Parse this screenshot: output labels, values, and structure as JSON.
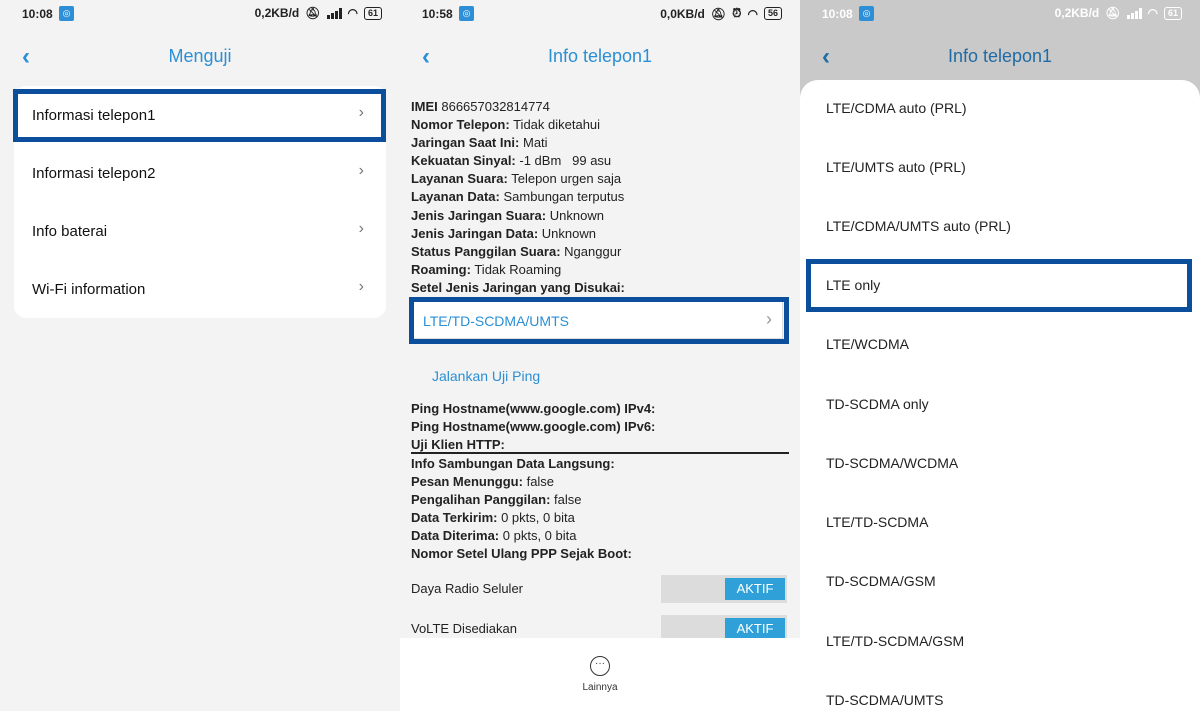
{
  "screen1": {
    "status": {
      "time": "10:08",
      "speed": "0,2KB/d",
      "battery": "61"
    },
    "header": {
      "title": "Menguji"
    },
    "menu": [
      {
        "label": "Informasi telepon1"
      },
      {
        "label": "Informasi telepon2"
      },
      {
        "label": "Info baterai"
      },
      {
        "label": "Wi-Fi information"
      }
    ]
  },
  "screen2": {
    "status": {
      "time": "10:58",
      "speed": "0,0KB/d",
      "battery": "56"
    },
    "header": {
      "title": "Info telepon1"
    },
    "info": [
      {
        "k": "IMEI",
        "v": "866657032814774"
      },
      {
        "k": "Nomor Telepon:",
        "v": "Tidak diketahui"
      },
      {
        "k": "Jaringan Saat Ini:",
        "v": "Mati"
      },
      {
        "k": "Kekuatan Sinyal:",
        "v": "-1 dBm   99 asu"
      },
      {
        "k": "Layanan Suara:",
        "v": "Telepon urgen saja"
      },
      {
        "k": "Layanan Data:",
        "v": "Sambungan terputus"
      },
      {
        "k": "Jenis Jaringan Suara:",
        "v": "Unknown"
      },
      {
        "k": "Jenis Jaringan Data:",
        "v": "Unknown"
      },
      {
        "k": "Status Panggilan Suara:",
        "v": "Nganggur"
      },
      {
        "k": "Roaming:",
        "v": "Tidak Roaming"
      },
      {
        "k": "Setel Jenis Jaringan yang Disukai:",
        "v": ""
      }
    ],
    "preferred_network": "LTE/TD-SCDMA/UMTS",
    "ping_button": "Jalankan Uji Ping",
    "ping": [
      {
        "k": "Ping Hostname(www.google.com) IPv4:",
        "v": ""
      },
      {
        "k": "Ping Hostname(www.google.com) IPv6:",
        "v": ""
      },
      {
        "k": "Uji Klien HTTP:",
        "v": ""
      }
    ],
    "data_info": [
      {
        "k": "Info Sambungan Data Langsung:",
        "v": ""
      },
      {
        "k": "Pesan Menunggu:",
        "v": "false"
      },
      {
        "k": "Pengalihan Panggilan:",
        "v": "false"
      },
      {
        "k": "Data Terkirim:",
        "v": "0 pkts, 0 bita"
      },
      {
        "k": "Data Diterima:",
        "v": "0 pkts, 0 bita"
      },
      {
        "k": "Nomor Setel Ulang PPP Sejak Boot:",
        "v": ""
      }
    ],
    "toggles": [
      {
        "label": "Daya Radio Seluler",
        "state": "AKTIF"
      },
      {
        "label": "VoLTE Disediakan",
        "state": "AKTIF"
      }
    ],
    "bottom": {
      "more_label": "Lainnya"
    }
  },
  "screen3": {
    "status": {
      "time": "10:08",
      "speed": "0,2KB/d",
      "battery": "61"
    },
    "header": {
      "title": "Info telepon1"
    },
    "options": [
      "LTE/CDMA auto (PRL)",
      "LTE/UMTS auto (PRL)",
      "LTE/CDMA/UMTS auto (PRL)",
      "LTE only",
      "LTE/WCDMA",
      "TD-SCDMA only",
      "TD-SCDMA/WCDMA",
      "LTE/TD-SCDMA",
      "TD-SCDMA/GSM",
      "LTE/TD-SCDMA/GSM",
      "TD-SCDMA/UMTS"
    ]
  },
  "colors": {
    "accent": "#2a8fd4",
    "highlight": "#0b4f9c",
    "toggle_on": "#2fa0d8"
  }
}
